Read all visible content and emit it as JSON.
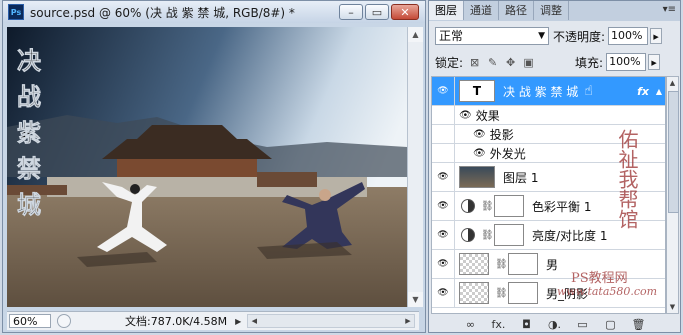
{
  "document": {
    "title": "source.psd @ 60% (决 战 紫 禁 城, RGB/8#) *",
    "app_badge": "Ps",
    "zoom": "60%",
    "doc_info": "文档:787.0K/4.58M",
    "buttons": {
      "minimize": "–",
      "restore": "▭",
      "close": "✕"
    },
    "canvas_text": [
      "决",
      "战",
      "紫",
      "禁",
      "城"
    ]
  },
  "panel": {
    "tabs": [
      "图层",
      "通道",
      "路径",
      "调整"
    ],
    "menu_icon": "▾≡",
    "blend_mode": "正常",
    "opacity_label": "不透明度:",
    "opacity_value": "100%",
    "lock_label": "锁定:",
    "fill_label": "填充:",
    "fill_value": "100%",
    "layers": [
      {
        "name": "决 战 紫 禁 城",
        "thumb": "T",
        "fx": "fx",
        "selected": true
      },
      {
        "name": "效果",
        "sub": true
      },
      {
        "name": "投影",
        "sub": true
      },
      {
        "name": "外发光",
        "sub": true
      },
      {
        "name": "图层 1"
      },
      {
        "name": "色彩平衡 1"
      },
      {
        "name": "亮度/对比度 1"
      },
      {
        "name": "男"
      },
      {
        "name": "男_阴影"
      }
    ],
    "bottom_icons": [
      "link-icon",
      "fx-icon",
      "mask-icon",
      "adjustment-icon",
      "folder-icon",
      "new-layer-icon",
      "trash-icon"
    ],
    "bottom_glyphs": [
      "∞",
      "fx.",
      "◘",
      "◑.",
      "▭",
      "▢",
      "🗑"
    ]
  },
  "watermark": {
    "side_text": "佑祉我帮馆",
    "url": "www.tata580.com",
    "site": "PS教程网"
  },
  "colors": {
    "selection": "#3399ff",
    "title_gradient_top": "#e7eef7",
    "panel_bg": "#e2e7ee"
  }
}
